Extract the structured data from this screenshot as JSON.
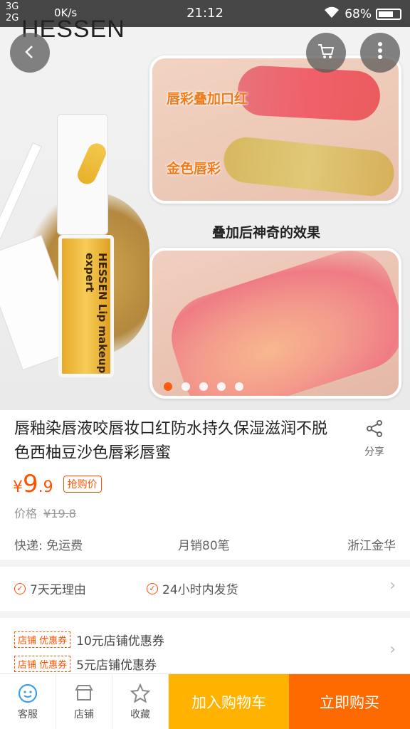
{
  "status_bar": {
    "network_top": "3G",
    "network_bottom": "2G",
    "speed": "0K/s",
    "time": "21:12",
    "battery": "68%"
  },
  "hero": {
    "brand": "HESSEN",
    "swatch_label_1": "唇彩叠加口红",
    "swatch_label_2": "金色唇彩",
    "effect_caption": "叠加后神奇的效果",
    "tube_label": "HESSEN Lip makeup expert",
    "carousel_count": 5,
    "carousel_active_index": 0
  },
  "icons": {
    "back": "chevron-left-icon",
    "cart": "cart-icon",
    "more": "more-vertical-icon",
    "share": "share-icon",
    "service": "customer-service-icon",
    "shop": "shop-icon",
    "favorite": "star-icon"
  },
  "product": {
    "title": "唇釉染唇液咬唇妆口红防水持久保湿滋润不脱色西柚豆沙色唇彩唇蜜",
    "share_label": "分享",
    "price_symbol": "¥",
    "price_int": "9",
    "price_dec": ".9",
    "price_tag": "抢购价",
    "orig_label": "价格",
    "orig_price": "¥19.8",
    "shipping": "快递: 免运费",
    "monthly_sales": "月销80笔",
    "location": "浙江金华"
  },
  "services": [
    {
      "label": "7天无理由"
    },
    {
      "label": "24小时内发货"
    }
  ],
  "coupons": [
    {
      "tag": "店铺 优惠券",
      "text": "10元店铺优惠券"
    },
    {
      "tag": "店铺 优惠券",
      "text": "5元店铺优惠券"
    }
  ],
  "bottom_bar": {
    "service_label": "客服",
    "shop_label": "店铺",
    "favorite_label": "收藏",
    "add_cart_label": "加入购物车",
    "buy_now_label": "立即购买"
  },
  "colors": {
    "accent": "#ff5000",
    "add_cart": "#ffb300",
    "buy_now": "#ff6a00"
  }
}
